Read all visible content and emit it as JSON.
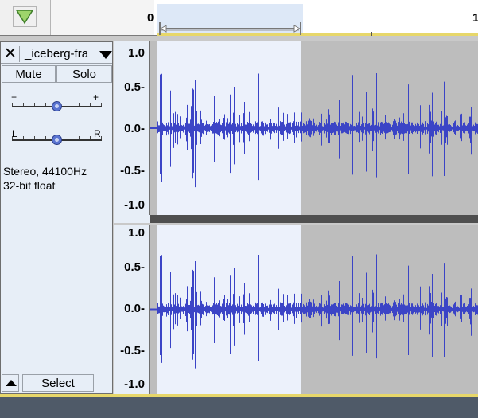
{
  "colors": {
    "waveform": "#3b44c6",
    "selected_background": "#ecf1fb",
    "unselected_background": "#bdbdbd",
    "panel_background": "#e7eef7",
    "pin_green": "#9ed46b"
  },
  "timeline": {
    "labels": [
      "0",
      "1"
    ]
  },
  "track": {
    "name": "_iceberg-fra",
    "close_symbol": "✕",
    "mute_label": "Mute",
    "solo_label": "Solo",
    "gain_minus": "−",
    "gain_plus": "+",
    "pan_left": "L",
    "pan_right": "R",
    "format_line1": "Stereo, 44100Hz",
    "format_line2": "32-bit float",
    "select_label": "Select",
    "gain_level": 0.5,
    "pan_level": 0.5
  },
  "vertical_ruler": {
    "labels": [
      "1.0",
      "0.5-",
      "0.0-",
      "-0.5-",
      "-1.0"
    ]
  },
  "selection": {
    "start_fraction": 0.0,
    "end_fraction": 0.45
  },
  "icons": {
    "pin": "triangle-down-green",
    "collapse": "triangle-up",
    "name_menu": "triangle-down"
  }
}
